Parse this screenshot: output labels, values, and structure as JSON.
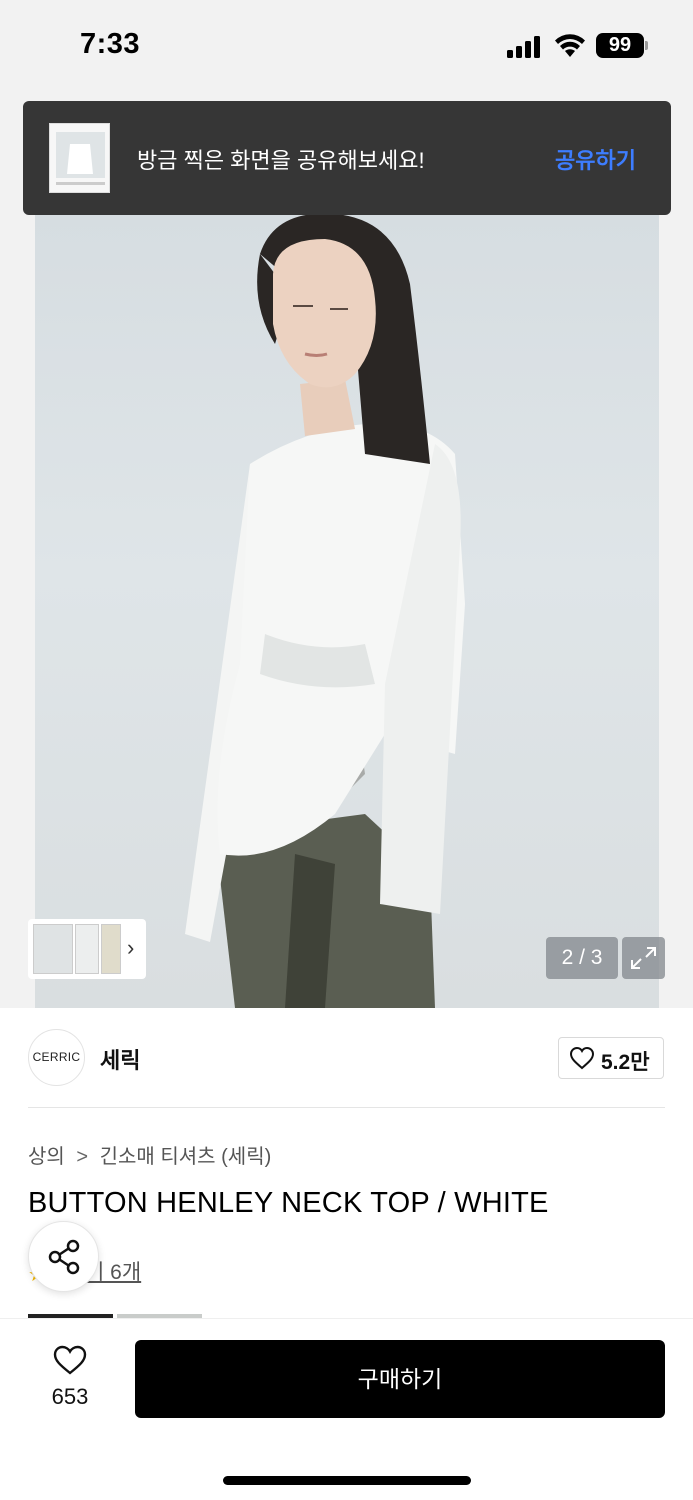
{
  "status_bar": {
    "time": "7:33",
    "battery": "99",
    "icons": [
      "cellular-signal-icon",
      "wifi-icon",
      "battery-icon"
    ]
  },
  "toast": {
    "message": "방금 찍은 화면을 공유해보세요!",
    "action_label": "공유하기",
    "action_color": "#3d7dff"
  },
  "gallery": {
    "current": "2",
    "total": "3",
    "indicator": "2 / 3",
    "thumbnail_chevron": "›",
    "icons": [
      "expand-icon",
      "chevron-right-icon"
    ]
  },
  "brand": {
    "logo_text": "CERRIC",
    "name": "세릭",
    "like_count": "5.2만"
  },
  "breadcrumb": {
    "items": [
      "상의",
      "긴소매 티셔츠 (세릭)"
    ],
    "separator": ">"
  },
  "product": {
    "title": "BUTTON HENLEY NECK TOP / WHITE",
    "review_label": "후기 6개",
    "review_visible": "기 6개"
  },
  "bottom_bar": {
    "wish_count": "653",
    "buy_label": "구매하기"
  },
  "colors": {
    "toast_bg": "#363636",
    "buy_button_bg": "#000000",
    "accent_blue": "#3d7dff"
  }
}
